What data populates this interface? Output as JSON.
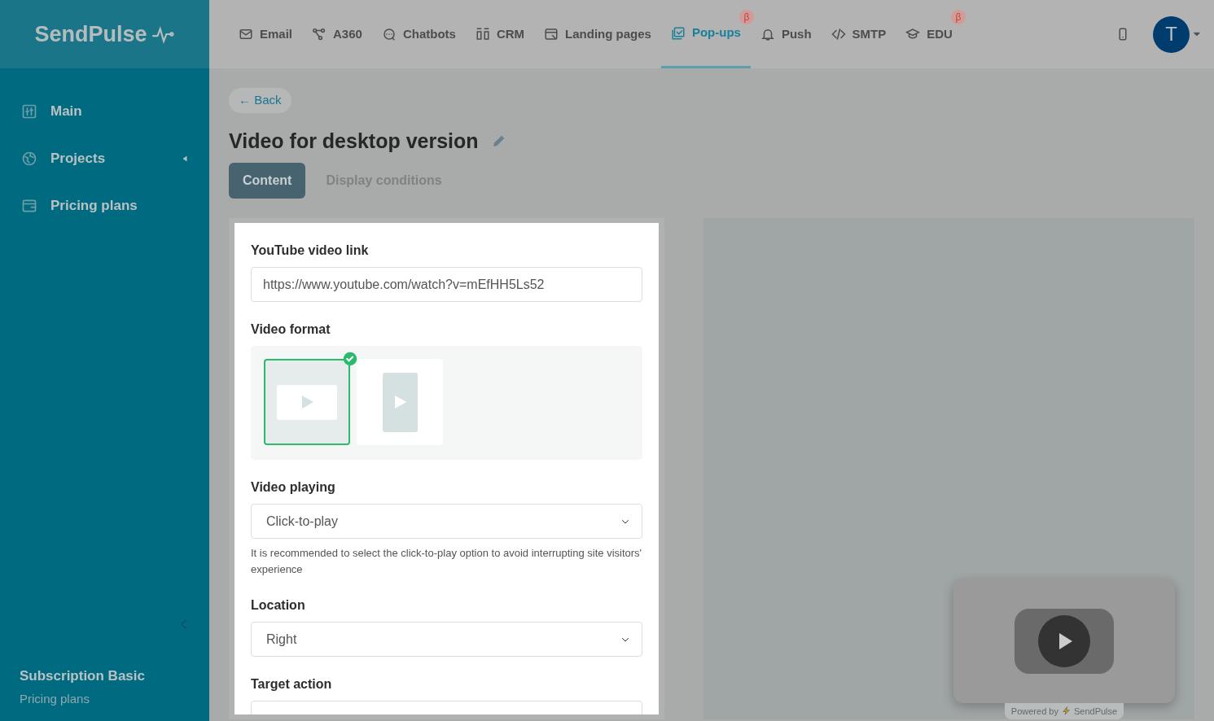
{
  "sidebar": {
    "logo": "SendPulse",
    "items": [
      {
        "label": "Main",
        "selected": false,
        "submenu": false
      },
      {
        "label": "Projects",
        "selected": false,
        "submenu": true
      },
      {
        "label": "Pricing plans",
        "selected": false,
        "submenu": false
      }
    ],
    "plan": "Subscription Basic",
    "plan_link": "Pricing plans"
  },
  "topnav": {
    "items": [
      {
        "label": "Email",
        "selected": false
      },
      {
        "label": "A360",
        "selected": false
      },
      {
        "label": "Chatbots",
        "selected": false
      },
      {
        "label": "CRM",
        "selected": false
      },
      {
        "label": "Landing pages",
        "selected": false
      },
      {
        "label": "Pop-ups",
        "selected": true,
        "badge": "β"
      },
      {
        "label": "Push",
        "selected": false
      },
      {
        "label": "SMTP",
        "selected": false
      },
      {
        "label": "EDU",
        "selected": false,
        "badge": "β"
      }
    ],
    "avatar": "T"
  },
  "page": {
    "back": "← Back",
    "title": "Video for desktop version",
    "tabs": [
      {
        "label": "Content",
        "selected": true
      },
      {
        "label": "Display conditions",
        "selected": false
      }
    ]
  },
  "form": {
    "link_label": "YouTube video link",
    "link_value": "https://www.youtube.com/watch?v=mEfHH5Ls52",
    "format_label": "Video format",
    "formats": [
      {
        "kind": "landscape",
        "selected": true
      },
      {
        "kind": "portrait",
        "selected": false
      }
    ],
    "playing_label": "Video playing",
    "playing_value": "Click-to-play",
    "playing_hint": "It is recommended to select the click-to-play option to avoid interrupting site visitors' experience",
    "location_label": "Location",
    "location_value": "Right",
    "target_label": "Target action"
  },
  "preview": {
    "powered": "Powered by",
    "brand": "SendPulse"
  }
}
